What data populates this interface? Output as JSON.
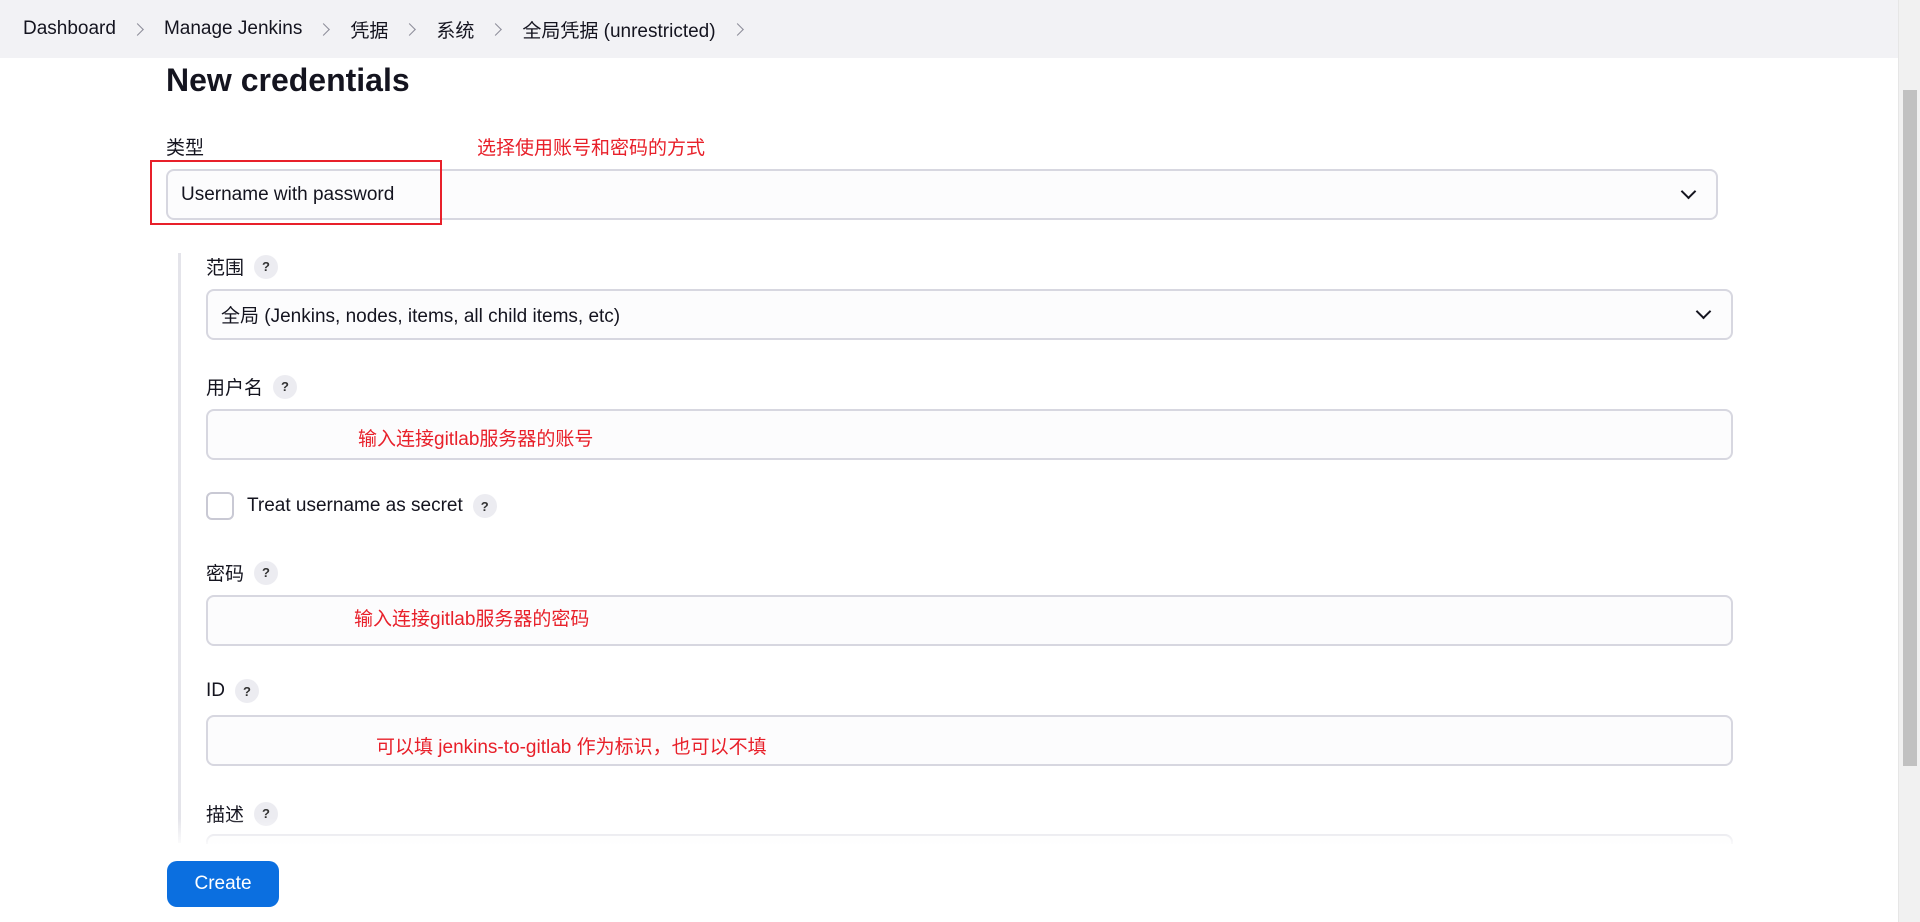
{
  "breadcrumb": [
    "Dashboard",
    "Manage Jenkins",
    "凭据",
    "系统",
    "全局凭据 (unrestricted)"
  ],
  "page": {
    "title": "New credentials"
  },
  "form": {
    "kind_label": "类型",
    "kind_value": "Username with password",
    "scope_label": "范围",
    "scope_value": "全局 (Jenkins, nodes, items, all child items, etc)",
    "username_label": "用户名",
    "username_value": "",
    "secret_checkbox_label": "Treat username as secret",
    "password_label": "密码",
    "password_value": "",
    "id_label": "ID",
    "id_value": "",
    "description_label": "描述",
    "help_glyph": "?"
  },
  "annotations": {
    "kind_note": "选择使用账号和密码的方式",
    "username_note": "输入连接gitlab服务器的账号",
    "password_note": "输入连接gitlab服务器的密码",
    "id_note": "可以填 jenkins-to-gitlab 作为标识，也可以不填"
  },
  "actions": {
    "create_label": "Create"
  },
  "colors": {
    "accent": "#0b6fe0",
    "annotation": "#e8202a"
  }
}
